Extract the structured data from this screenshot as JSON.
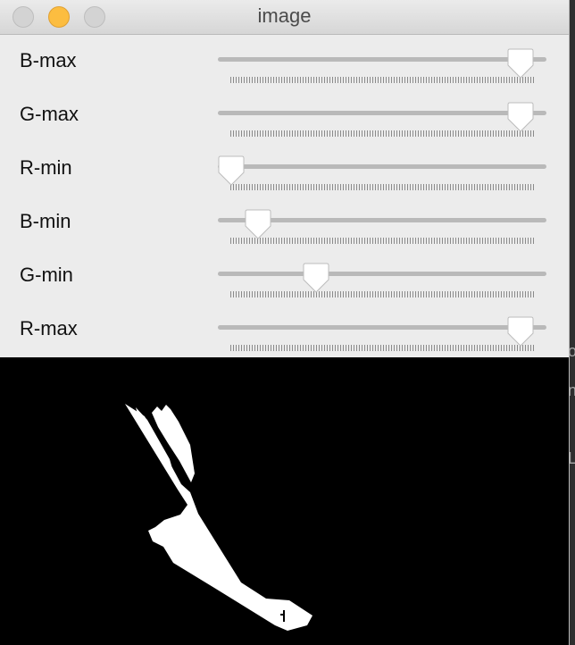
{
  "window": {
    "title": "image"
  },
  "trackbars": [
    {
      "id": "b-max",
      "label": "B-max",
      "value_fraction": 0.96
    },
    {
      "id": "g-max",
      "label": "G-max",
      "value_fraction": 0.96
    },
    {
      "id": "r-min",
      "label": "R-min",
      "value_fraction": 0.0
    },
    {
      "id": "b-min",
      "label": "B-min",
      "value_fraction": 0.09
    },
    {
      "id": "g-min",
      "label": "G-min",
      "value_fraction": 0.28
    },
    {
      "id": "r-max",
      "label": "R-max",
      "value_fraction": 0.96
    }
  ],
  "background_glyphs": [
    "o",
    "n",
    "L"
  ],
  "colors": {
    "window_bg": "#ececec",
    "minimize_light": "#fcbd40",
    "mask_bg": "#000000",
    "mask_fg": "#ffffff"
  }
}
